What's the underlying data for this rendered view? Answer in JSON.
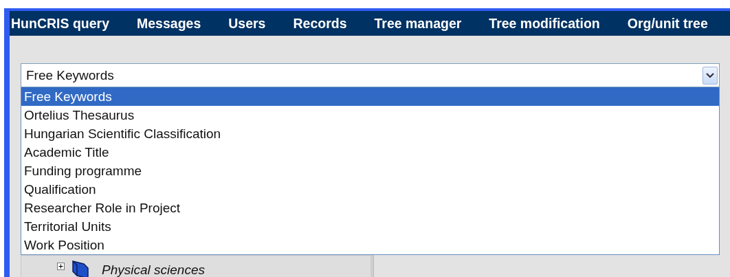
{
  "nav": [
    {
      "label": "HunCRIS query"
    },
    {
      "label": "Messages"
    },
    {
      "label": "Users"
    },
    {
      "label": "Records"
    },
    {
      "label": "Tree manager"
    },
    {
      "label": "Tree modification"
    },
    {
      "label": "Org/unit tree"
    }
  ],
  "select": {
    "value": "Free Keywords",
    "expanded": true,
    "options": [
      {
        "label": "Free Keywords",
        "selected": true
      },
      {
        "label": "Ortelius Thesaurus",
        "selected": false
      },
      {
        "label": "Hungarian Scientific Classification",
        "selected": false
      },
      {
        "label": "Academic Title",
        "selected": false
      },
      {
        "label": "Funding programme",
        "selected": false
      },
      {
        "label": "Qualification",
        "selected": false
      },
      {
        "label": "Researcher Role in Project",
        "selected": false
      },
      {
        "label": "Territorial Units",
        "selected": false
      },
      {
        "label": "Work Position",
        "selected": false
      }
    ]
  },
  "tree": [
    {
      "label": "Physical sciences",
      "expanded": false
    }
  ]
}
